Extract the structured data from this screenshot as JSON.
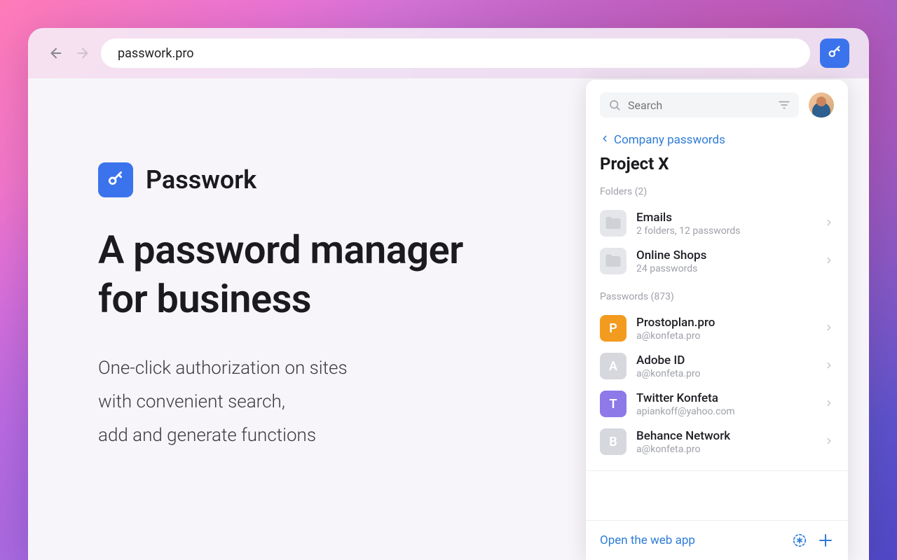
{
  "browser": {
    "url": "passwork.pro"
  },
  "hero": {
    "brand": "Passwork",
    "headline_l1": "A password manager",
    "headline_l2": "for business",
    "sub_l1": "One-click authorization on sites",
    "sub_l2": "with convenient search,",
    "sub_l3": "add and generate functions"
  },
  "panel": {
    "search_placeholder": "Search",
    "breadcrumb": "Company passwords",
    "title": "Project X",
    "folders_label": "Folders (2)",
    "passwords_label": "Passwords (873)",
    "open_webapp": "Open the web app",
    "folders": [
      {
        "name": "Emails",
        "sub": "2 folders, 12 passwords"
      },
      {
        "name": "Online Shops",
        "sub": "24 passwords"
      }
    ],
    "passwords": [
      {
        "letter": "P",
        "color": "#f39b1f",
        "name": "Prostoplan.pro",
        "sub": "a@konfeta.pro"
      },
      {
        "letter": "A",
        "color": "#d6d8dd",
        "name": "Adobe ID",
        "sub": "a@konfeta.pro"
      },
      {
        "letter": "T",
        "color": "#8e79e8",
        "name": "Twitter Konfeta",
        "sub": "apiankoff@yahoo.com"
      },
      {
        "letter": "B",
        "color": "#d6d8dd",
        "name": "Behance Network",
        "sub": "a@konfeta.pro"
      }
    ]
  },
  "colors": {
    "accent": "#3b73ed",
    "link": "#2e7cd6"
  }
}
